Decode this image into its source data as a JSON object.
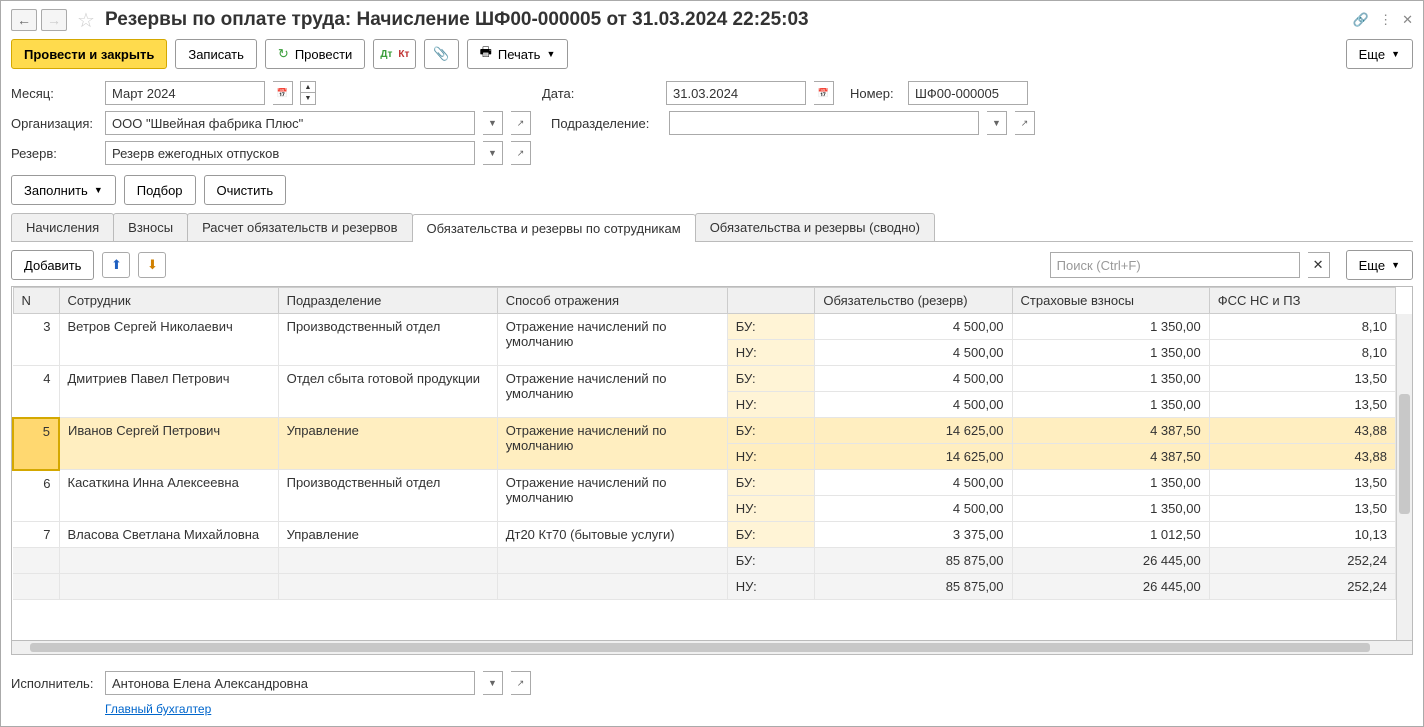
{
  "title": "Резервы по оплате труда: Начисление ШФ00-000005 от 31.03.2024 22:25:03",
  "toolbar": {
    "post_close": "Провести и закрыть",
    "save": "Записать",
    "post": "Провести",
    "print": "Печать",
    "more": "Еще"
  },
  "form": {
    "month_label": "Месяц:",
    "month_value": "Март 2024",
    "date_label": "Дата:",
    "date_value": "31.03.2024",
    "number_label": "Номер:",
    "number_value": "ШФ00-000005",
    "org_label": "Организация:",
    "org_value": "ООО \"Швейная фабрика Плюс\"",
    "dept_label": "Подразделение:",
    "dept_value": "",
    "reserve_label": "Резерв:",
    "reserve_value": "Резерв ежегодных отпусков"
  },
  "subtoolbar": {
    "fill": "Заполнить",
    "pick": "Подбор",
    "clear": "Очистить"
  },
  "tabs": [
    "Начисления",
    "Взносы",
    "Расчет обязательств и резервов",
    "Обязательства и резервы по сотрудникам",
    "Обязательства и резервы (сводно)"
  ],
  "active_tab": 3,
  "tabletools": {
    "add": "Добавить",
    "search_placeholder": "Поиск (Ctrl+F)",
    "more": "Еще"
  },
  "columns": [
    "N",
    "Сотрудник",
    "Подразделение",
    "Способ отражения",
    "",
    "Обязательство (резерв)",
    "Страховые взносы",
    "ФСС НС и ПЗ"
  ],
  "rows": [
    {
      "n": 3,
      "emp": "Ветров Сергей Николаевич",
      "dept": "Производственный отдел",
      "refl": "Отражение начислений по умолчанию",
      "sel": false,
      "bu": {
        "акт": "БУ:",
        "ob": "4 500,00",
        "sv": "1 350,00",
        "fss": "8,10"
      },
      "nu": {
        "акт": "НУ:",
        "ob": "4 500,00",
        "sv": "1 350,00",
        "fss": "8,10"
      }
    },
    {
      "n": 4,
      "emp": "Дмитриев Павел Петрович",
      "dept": "Отдел сбыта готовой продукции",
      "refl": "Отражение начислений по умолчанию",
      "sel": false,
      "bu": {
        "акт": "БУ:",
        "ob": "4 500,00",
        "sv": "1 350,00",
        "fss": "13,50"
      },
      "nu": {
        "акт": "НУ:",
        "ob": "4 500,00",
        "sv": "1 350,00",
        "fss": "13,50"
      }
    },
    {
      "n": 5,
      "emp": "Иванов Сергей Петрович",
      "dept": "Управление",
      "refl": "Отражение начислений по умолчанию",
      "sel": true,
      "bu": {
        "акт": "БУ:",
        "ob": "14 625,00",
        "sv": "4 387,50",
        "fss": "43,88"
      },
      "nu": {
        "акт": "НУ:",
        "ob": "14 625,00",
        "sv": "4 387,50",
        "fss": "43,88"
      }
    },
    {
      "n": 6,
      "emp": "Касаткина Инна Алексеевна",
      "dept": "Производственный отдел",
      "refl": "Отражение начислений по умолчанию",
      "sel": false,
      "bu": {
        "акт": "БУ:",
        "ob": "4 500,00",
        "sv": "1 350,00",
        "fss": "13,50"
      },
      "nu": {
        "акт": "НУ:",
        "ob": "4 500,00",
        "sv": "1 350,00",
        "fss": "13,50"
      }
    },
    {
      "n": 7,
      "emp": "Власова Светлана Михайловна",
      "dept": "Управление",
      "refl": "Дт20  Кт70 (бытовые услуги)",
      "sel": false,
      "bu": {
        "акт": "БУ:",
        "ob": "3 375,00",
        "sv": "1 012,50",
        "fss": "10,13"
      },
      "nu": null
    }
  ],
  "totals": {
    "bu": {
      "акт": "БУ:",
      "ob": "85 875,00",
      "sv": "26 445,00",
      "fss": "252,24"
    },
    "nu": {
      "акт": "НУ:",
      "ob": "85 875,00",
      "sv": "26 445,00",
      "fss": "252,24"
    }
  },
  "footer": {
    "exec_label": "Исполнитель:",
    "exec_value": "Антонова Елена Александровна",
    "role_link": "Главный бухгалтер"
  }
}
